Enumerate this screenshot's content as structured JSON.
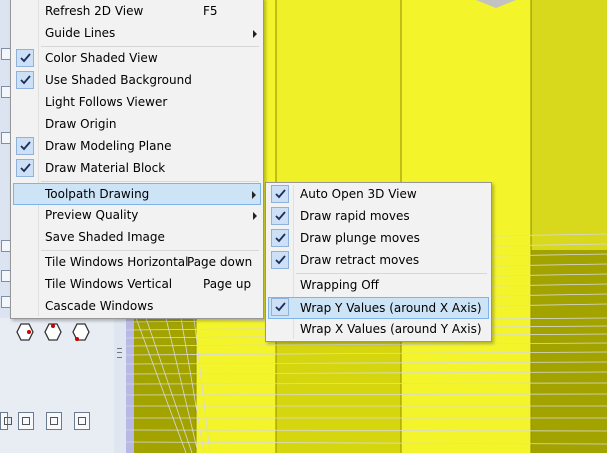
{
  "main_menu": {
    "items": [
      {
        "label": "Refresh 2D View",
        "shortcut": "F5",
        "checked": false,
        "submenu": false
      },
      {
        "label": "Guide Lines",
        "shortcut": "",
        "checked": false,
        "submenu": true
      },
      {
        "label": "Color Shaded View",
        "shortcut": "",
        "checked": true,
        "submenu": false
      },
      {
        "label": "Use Shaded Background",
        "shortcut": "",
        "checked": true,
        "submenu": false
      },
      {
        "label": "Light Follows Viewer",
        "shortcut": "",
        "checked": false,
        "submenu": false
      },
      {
        "label": "Draw Origin",
        "shortcut": "",
        "checked": false,
        "submenu": false
      },
      {
        "label": "Draw Modeling Plane",
        "shortcut": "",
        "checked": true,
        "submenu": false
      },
      {
        "label": "Draw Material Block",
        "shortcut": "",
        "checked": true,
        "submenu": false
      },
      {
        "label": "Toolpath Drawing",
        "shortcut": "",
        "checked": false,
        "submenu": true,
        "highlighted": true
      },
      {
        "label": "Preview Quality",
        "shortcut": "",
        "checked": false,
        "submenu": true
      },
      {
        "label": "Save Shaded Image",
        "shortcut": "",
        "checked": false,
        "submenu": false
      },
      {
        "label": "Tile Windows Horizontal",
        "shortcut": "Page down",
        "checked": false,
        "submenu": false
      },
      {
        "label": "Tile Windows Vertical",
        "shortcut": "Page up",
        "checked": false,
        "submenu": false
      },
      {
        "label": "Cascade Windows",
        "shortcut": "",
        "checked": false,
        "submenu": false
      }
    ]
  },
  "toolpath_submenu": {
    "items": [
      {
        "label": "Auto Open 3D View",
        "checked": true
      },
      {
        "label": "Draw rapid moves",
        "checked": true
      },
      {
        "label": "Draw plunge moves",
        "checked": true
      },
      {
        "label": "Draw retract moves",
        "checked": true
      },
      {
        "label": "Wrapping Off",
        "checked": false
      },
      {
        "label": "Wrap Y Values (around X Axis)",
        "checked": true,
        "highlighted": true
      },
      {
        "label": "Wrap X Values (around Y Axis)",
        "checked": false
      }
    ]
  },
  "colors": {
    "menu_bg": "#f2f2f2",
    "highlight": "#cde4f7",
    "check_bg": "#cde0f5",
    "model_yellow": "#f4f42a",
    "model_olive": "#a3a300",
    "viewport_bg": "#b8b8e6"
  }
}
